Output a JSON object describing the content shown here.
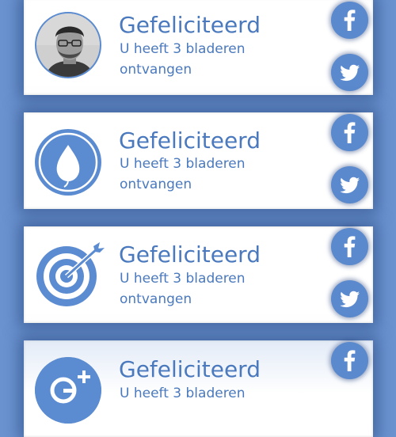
{
  "notifications": [
    {
      "avatar_icon": "user-photo",
      "title": "Gefeliciteerd",
      "message": "U heeft 3 bladeren ontvangen",
      "share_facebook": "facebook-icon",
      "share_twitter": "twitter-icon"
    },
    {
      "avatar_icon": "leaf-icon",
      "title": "Gefeliciteerd",
      "message": "U heeft 3 bladeren ontvangen",
      "share_facebook": "facebook-icon",
      "share_twitter": "twitter-icon"
    },
    {
      "avatar_icon": "target-icon",
      "title": "Gefeliciteerd",
      "message": "U heeft 3 bladeren ontvangen",
      "share_facebook": "facebook-icon",
      "share_twitter": "twitter-icon"
    },
    {
      "avatar_icon": "google-plus-icon",
      "title": "Gefeliciteerd",
      "message": "U heeft 3 bladeren",
      "share_facebook": "facebook-icon"
    }
  ],
  "colors": {
    "background": "#6a93cf",
    "accent": "#4a79bd",
    "icon_circle": "#5a89ce",
    "card": "#ffffff"
  }
}
